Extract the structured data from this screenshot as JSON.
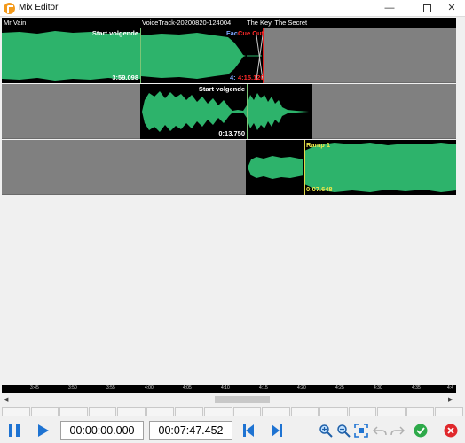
{
  "window": {
    "title": "Mix Editor",
    "minimize_glyph": "—",
    "close_glyph": "✕"
  },
  "header": {
    "left": "Mr Vain",
    "center": "VoiceTrack-20200820-124004",
    "right": "The Key, The Secret"
  },
  "tracks": [
    {
      "clips": [
        {
          "label": "Start volgende",
          "time": "3:59.098"
        },
        {
          "fade_label": "Fac",
          "cue_label": "Cue Out",
          "time_prefix": "4:",
          "time_red": "4:15.120"
        }
      ]
    },
    {
      "clips": [
        {
          "label": "Start volgende",
          "time": "0:13.750"
        }
      ]
    },
    {
      "clips": [
        {
          "label": "Ramp 1",
          "time": "0:07.648"
        }
      ]
    }
  ],
  "ruler": {
    "ticks": [
      "3:45",
      "3:50",
      "3:55",
      "4:00",
      "4:05",
      "4:10",
      "4:15",
      "4:20",
      "4:25",
      "4:30",
      "4:35",
      "4:4"
    ]
  },
  "toolbar": {
    "position": "00:00:00.000",
    "duration": "00:07:47.452"
  },
  "colors": {
    "waveform": "#2db36b",
    "marker_green": "#7cc576",
    "marker_yellow": "#e0d84a",
    "cue_red": "#e02020",
    "transport_blue": "#1e73d2"
  },
  "icons": [
    "app-logo-icon",
    "pause-icon",
    "play-icon",
    "skip-start-icon",
    "skip-end-icon",
    "zoom-in-icon",
    "zoom-out-icon",
    "zoom-fit-icon",
    "undo-icon",
    "redo-icon",
    "ok-icon",
    "cancel-icon"
  ]
}
